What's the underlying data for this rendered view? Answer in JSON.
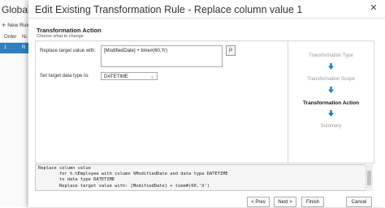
{
  "background": {
    "title": "Global Ru",
    "new_rule_label": "New Rule",
    "grid_headers": [
      "Order",
      "Ni"
    ],
    "grid_row": [
      "1",
      "R"
    ]
  },
  "dialog": {
    "title": "Edit Existing Transformation Rule - Replace column value 1",
    "close_glyph": "✕",
    "section_title": "Transformation Action",
    "section_subtitle": "Choose what to change",
    "replace_label": "Replace target value with:",
    "replace_value": "[ModifiedDate] + time#(60,'h')",
    "fx_label": "fx",
    "type_label": "Set target data type to:",
    "type_value": "DATETIME",
    "steps": [
      {
        "label": "Transformation Type",
        "active": false
      },
      {
        "label": "Transformation Scope",
        "active": false
      },
      {
        "label": "Transformation Action",
        "active": true
      },
      {
        "label": "Summary",
        "active": false
      }
    ],
    "script_lines": [
      "Replace column value",
      "        for %.%Employee with column %ModifiedDate and data type DATETIME",
      "        to data type DATETIME",
      "        Replace target value with: [ModifiedDate] + time#(60,'h')"
    ],
    "buttons": {
      "prev": "< Prev",
      "next": "Next >",
      "finish": "Finish",
      "cancel": "Cancel"
    }
  },
  "colors": {
    "accent": "#2f7fc1",
    "arrow": "#1f7ac4"
  }
}
